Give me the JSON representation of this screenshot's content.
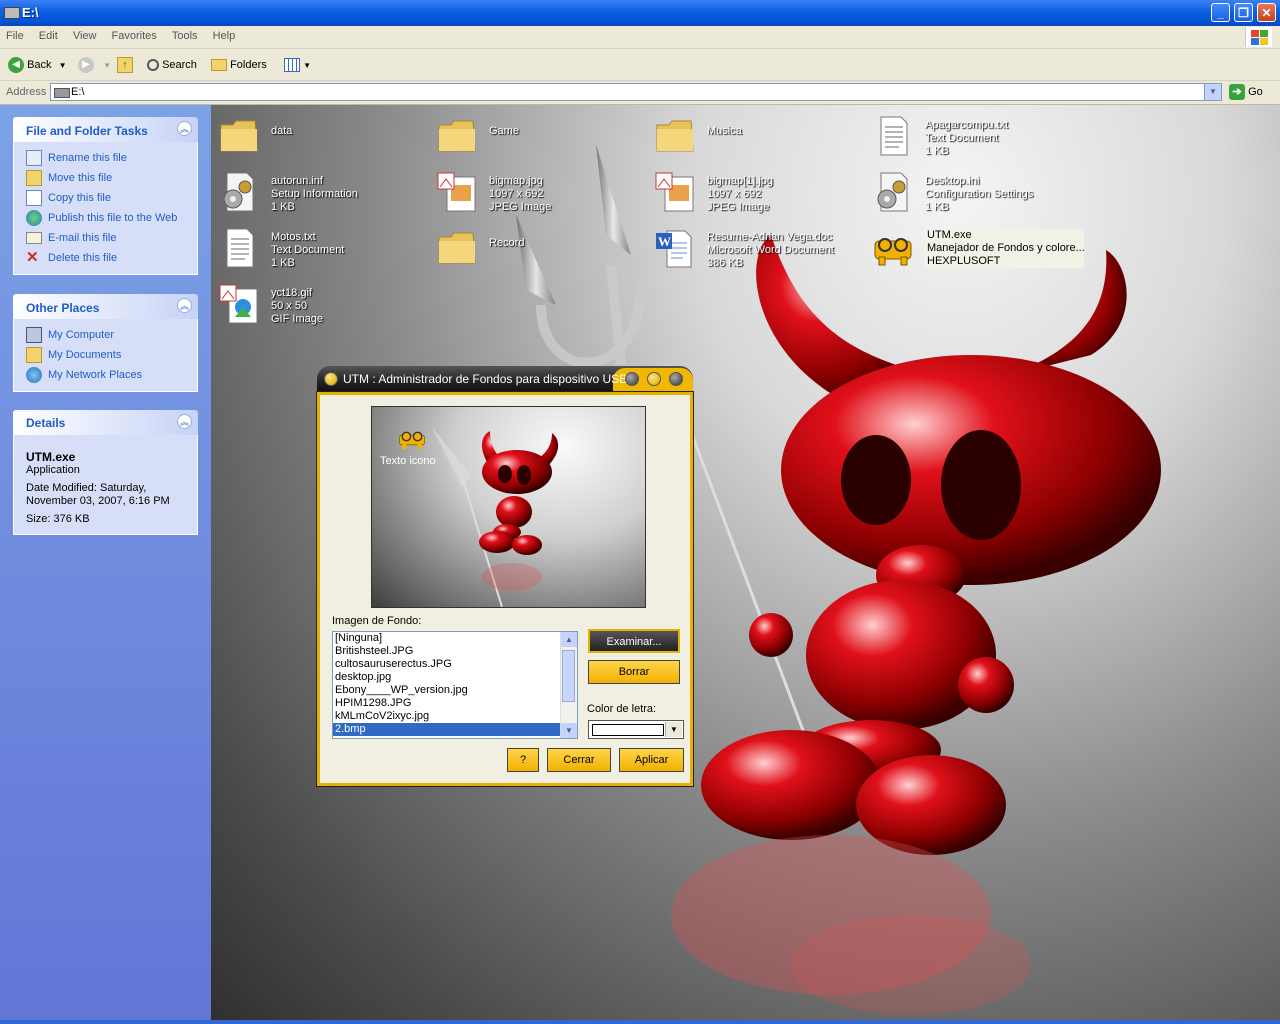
{
  "window": {
    "title": "E:\\"
  },
  "menu": [
    "File",
    "Edit",
    "View",
    "Favorites",
    "Tools",
    "Help"
  ],
  "toolbar": {
    "back": "Back",
    "search": "Search",
    "folders": "Folders"
  },
  "address": {
    "label": "Address",
    "value": "E:\\",
    "go": "Go"
  },
  "tasks_panel": {
    "title": "File and Folder Tasks",
    "items": [
      "Rename this file",
      "Move this file",
      "Copy this file",
      "Publish this file to the Web",
      "E-mail this file",
      "Delete this file"
    ]
  },
  "places_panel": {
    "title": "Other Places",
    "items": [
      "My Computer",
      "My Documents",
      "My Network Places"
    ]
  },
  "details_panel": {
    "title": "Details",
    "name": "UTM.exe",
    "type": "Application",
    "modified_1": "Date Modified: Saturday,",
    "modified_2": "November 03, 2007, 6:16 PM",
    "size": "Size: 376 KB"
  },
  "files": [
    {
      "name": "data",
      "l2": "",
      "l3": "",
      "icon": "folder-icon"
    },
    {
      "name": "Game",
      "l2": "",
      "l3": "",
      "icon": "folder-icon"
    },
    {
      "name": "Musica",
      "l2": "",
      "l3": "",
      "icon": "folder-icon"
    },
    {
      "name": "Apagarcompu.txt",
      "l2": "Text Document",
      "l3": "1 KB",
      "icon": "text-document-icon"
    },
    {
      "name": "autorun.inf",
      "l2": "Setup Information",
      "l3": "1 KB",
      "icon": "settings-file-icon"
    },
    {
      "name": "bigmap.jpg",
      "l2": "1097 x 692",
      "l3": "JPEG Image",
      "icon": "image-file-icon"
    },
    {
      "name": "bigmap[1].jpg",
      "l2": "1097 x 692",
      "l3": "JPEG Image",
      "icon": "image-file-icon"
    },
    {
      "name": "Desktop.ini",
      "l2": "Configuration Settings",
      "l3": "1 KB",
      "icon": "settings-file-icon"
    },
    {
      "name": "Motos.txt",
      "l2": "Text Document",
      "l3": "1 KB",
      "icon": "text-document-icon"
    },
    {
      "name": "Record",
      "l2": "",
      "l3": "",
      "icon": "folder-icon"
    },
    {
      "name": "Resume-Adrian Vega.doc",
      "l2": "Microsoft Word Document",
      "l3": "386 KB",
      "icon": "word-document-icon"
    },
    {
      "name": "UTM.exe",
      "l2": "Manejador de Fondos y colore...",
      "l3": "HEXPLUSOFT",
      "icon": "utm-app-icon"
    },
    {
      "name": "yct18.gif",
      "l2": "50 x 50",
      "l3": "GIF Image",
      "icon": "gif-image-icon"
    }
  ],
  "dialog": {
    "title": "UTM : Administrador de Fondos para dispositivo USB",
    "preview_icon_label": "Texto icono",
    "background_label": "Imagen de Fondo:",
    "list": [
      "[Ninguna]",
      "Britishsteel.JPG",
      "cultosauruserectus.JPG",
      "desktop.jpg",
      "Ebony____WP_version.jpg",
      "HPIM1298.JPG",
      "kMLmCoV2ixyc.jpg",
      "2.bmp"
    ],
    "selected_index": 7,
    "browse_button": "Examinar...",
    "delete_button": "Borrar",
    "font_color_label": "Color de letra:",
    "help_button": "?",
    "close_button": "Cerrar",
    "apply_button": "Aplicar"
  },
  "colors": {
    "titlebar": "#0454D8",
    "taskpane": "#6375D6",
    "link": "#215DC6",
    "accent_yellow": "#F2B000",
    "selection": "#316AC5"
  }
}
